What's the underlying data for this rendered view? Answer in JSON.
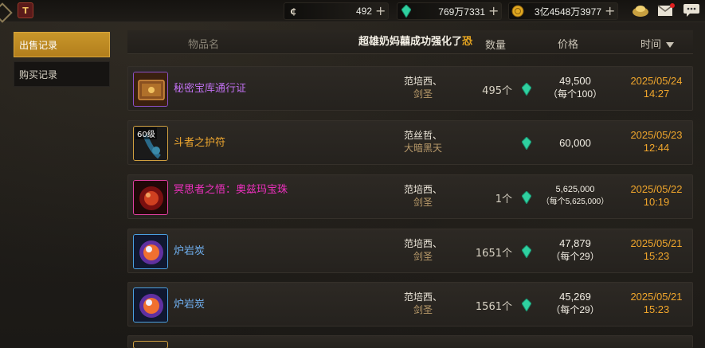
{
  "topbar": {
    "currencies": [
      {
        "icon": "coin-icon",
        "symbol": "₵",
        "value": "492"
      },
      {
        "icon": "gem-icon",
        "value": "769万7331"
      },
      {
        "icon": "gold-coin-icon",
        "value": "3亿4548万3977"
      }
    ],
    "plus": "+"
  },
  "tabs": [
    {
      "label": "出售记录",
      "active": true
    },
    {
      "label": "购买记录",
      "active": false
    }
  ],
  "header": {
    "item_col": "物品名",
    "broadcast": "超雄奶妈囍成功强化了",
    "broadcast_tail": "恐",
    "qty_col": "数量",
    "price_col": "价格",
    "time_col": "时间"
  },
  "rows": [
    {
      "name": "秘密宝库通行证",
      "name_color": "purple",
      "icon": "vault-pass-icon",
      "level": "",
      "seller": "范培西、",
      "server": "剑圣",
      "qty": "495个",
      "price": "49,500",
      "unit_price": "（每个100）",
      "date": "2025/05/24",
      "time": "14:27"
    },
    {
      "name": "斗者之护符",
      "name_color": "orange",
      "icon": "amulet-icon",
      "level": "60级",
      "seller": "范丝哲、",
      "server": "大暗黑天",
      "qty": "",
      "price": "60,000",
      "unit_price": "",
      "date": "2025/05/23",
      "time": "12:44"
    },
    {
      "name": "冥思者之悟：奥兹玛宝珠",
      "name_color": "pink",
      "icon": "orb-icon",
      "level": "",
      "seller": "范培西、",
      "server": "剑圣",
      "qty": "1个",
      "price": "5,625,000",
      "unit_price": "（每个5,625,000）",
      "date": "2025/05/22",
      "time": "10:19"
    },
    {
      "name": "炉岩炭",
      "name_color": "blue",
      "icon": "furnace-coal-icon",
      "level": "",
      "seller": "范培西、",
      "server": "剑圣",
      "qty": "1651个",
      "price": "47,879",
      "unit_price": "（每个29）",
      "date": "2025/05/21",
      "time": "15:23"
    },
    {
      "name": "炉岩炭",
      "name_color": "blue",
      "icon": "furnace-coal-icon",
      "level": "",
      "seller": "范培西、",
      "server": "剑圣",
      "qty": "1561个",
      "price": "45,269",
      "unit_price": "（每个29）",
      "date": "2025/05/21",
      "time": "15:23"
    }
  ],
  "colors": {
    "tab_active": "#c8962a",
    "time_text": "#f0a62c",
    "name_purple": "#c070f0",
    "name_orange": "#f0a830",
    "name_pink": "#f030c0",
    "name_blue": "#70b0f0"
  }
}
